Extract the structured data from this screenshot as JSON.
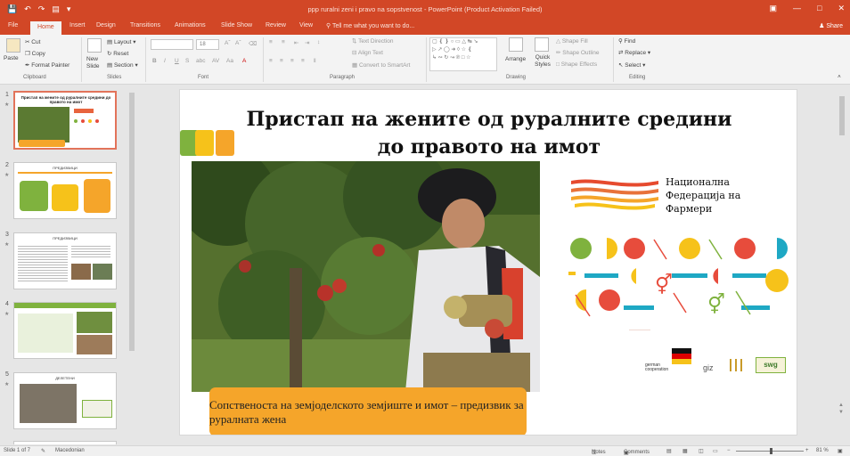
{
  "window": {
    "title": "ppp ruralni zeni i pravo na sopstvenost - PowerPoint (Product Activation Failed)"
  },
  "tabs": [
    "File",
    "Home",
    "Insert",
    "Design",
    "Transitions",
    "Animations",
    "Slide Show",
    "Review",
    "View"
  ],
  "tell_me": "Tell me what you want to do...",
  "share": "Share",
  "ribbon": {
    "clipboard": {
      "paste": "Paste",
      "cut": "Cut",
      "copy": "Copy",
      "format_painter": "Format Painter",
      "label": "Clipboard"
    },
    "slides": {
      "new_slide": "New Slide",
      "layout": "Layout",
      "reset": "Reset",
      "section": "Section",
      "label": "Slides"
    },
    "font": {
      "font_name": "",
      "font_size": "18",
      "label": "Font"
    },
    "paragraph": {
      "text_direction": "Text Direction",
      "align_text": "Align Text",
      "convert_smartart": "Convert to SmartArt",
      "label": "Paragraph"
    },
    "drawing": {
      "arrange": "Arrange",
      "quick_styles": "Quick Styles",
      "shape_fill": "Shape Fill",
      "shape_outline": "Shape Outline",
      "shape_effects": "Shape Effects",
      "label": "Drawing"
    },
    "editing": {
      "find": "Find",
      "replace": "Replace",
      "select": "Select",
      "label": "Editing"
    }
  },
  "thumbnails": [
    {
      "num": "1",
      "title": "Пристап на жените од руралните средини до правото на имот"
    },
    {
      "num": "2",
      "title": "ПРЕДИЗВИЦИ"
    },
    {
      "num": "3",
      "title": "ПРЕДИЗВИЦИ"
    },
    {
      "num": "4",
      "title": ""
    },
    {
      "num": "5",
      "title": "ДЕЛЕТЕНИ"
    }
  ],
  "slide": {
    "title_line1": "Пристап на жените од руралните средини",
    "title_line2": "до правото на имот",
    "logo_line1": "Национална",
    "logo_line2": "Федерација на",
    "logo_line3": "Фармери",
    "caption": "Сопственоста на земјоделското земјиште и имот – предизвик за руралната жена",
    "german_cooperation": "german cooperation",
    "giz": "giz",
    "swg": "swg"
  },
  "colors": {
    "accent": "#d24726",
    "orange": "#f5a52a",
    "green": "#7fb23e",
    "red": "#e74c3c",
    "yellow": "#f6c21a",
    "teal": "#1ea8c4"
  },
  "status": {
    "slide_info": "Slide 1 of 7",
    "language": "Macedonian",
    "notes": "Notes",
    "comments": "Comments",
    "zoom": "81 %"
  }
}
